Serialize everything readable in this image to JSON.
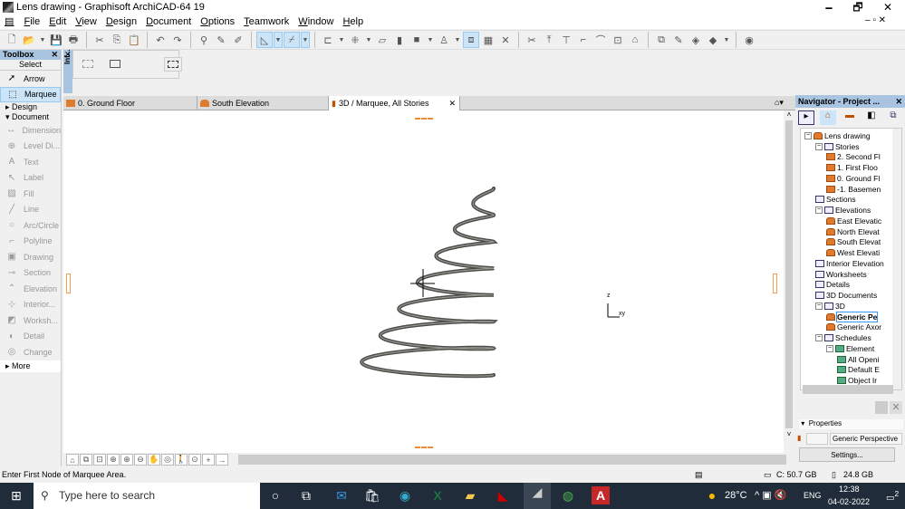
{
  "window": {
    "title": "Lens drawing - Graphisoft ArchiCAD-64 19",
    "minimize": "🗕",
    "maximize": "🗗",
    "close": "✕"
  },
  "menu": [
    "File",
    "Edit",
    "View",
    "Design",
    "Document",
    "Options",
    "Teamwork",
    "Window",
    "Help"
  ],
  "toolbar": [
    "new-file",
    "open-folder",
    "dd",
    "save",
    "print",
    "sep",
    "cut",
    "copy",
    "paste",
    "sep",
    "undo",
    "redo",
    "sep",
    "find-select",
    "eyedropper",
    "syringe",
    "sep",
    "guide-lines:act",
    "dd:act",
    "snap-guides:act",
    "dd:act",
    "sep",
    "align",
    "dd",
    "distribute",
    "dd",
    "slab-tool",
    "wall-tool",
    "fill-tool",
    "dd",
    "object-tool",
    "dd",
    "trace:act",
    "reference",
    "cross",
    "sep",
    "split",
    "adjust",
    "elevate",
    "fillet",
    "curve",
    "offset",
    "roof-tool",
    "sep",
    "layer-combo",
    "renovation",
    "graphic-override",
    "view-options",
    "dd",
    "sep",
    "bimx-publish"
  ],
  "toolbox": {
    "title": "Toolbox",
    "close": "✕",
    "select_label": "Select",
    "selection_tools": [
      {
        "label": "Arrow",
        "icon": "➚"
      },
      {
        "label": "Marquee",
        "icon": "⬚",
        "selected": true
      }
    ],
    "sections": {
      "design": "Design",
      "document": "Document",
      "more": "More"
    },
    "document_tools": [
      {
        "label": "Dimension",
        "icon": "↔"
      },
      {
        "label": "Level Di...",
        "icon": "⊕"
      },
      {
        "label": "Text",
        "icon": "A"
      },
      {
        "label": "Label",
        "icon": "↖"
      },
      {
        "label": "Fill",
        "icon": "▨"
      },
      {
        "label": "Line",
        "icon": "╱"
      },
      {
        "label": "Arc/Circle",
        "icon": "○"
      },
      {
        "label": "Polyline",
        "icon": "⌐"
      },
      {
        "label": "Drawing",
        "icon": "▣"
      },
      {
        "label": "Section",
        "icon": "⊸"
      },
      {
        "label": "Elevation",
        "icon": "⌃"
      },
      {
        "label": "Interior...",
        "icon": "⊹"
      },
      {
        "label": "Worksh...",
        "icon": "◩"
      },
      {
        "label": "Detail",
        "icon": "◐"
      },
      {
        "label": "Change",
        "icon": "◎"
      }
    ]
  },
  "infobox": {
    "side_label": "Inf...",
    "close": "✕"
  },
  "tabs": [
    {
      "label": "0. Ground Floor",
      "icon": "floor-plan"
    },
    {
      "label": "South Elevation",
      "icon": "elevation"
    },
    {
      "label": "3D / Marquee, All Stories",
      "icon": "camera",
      "active": true,
      "close": "✕"
    }
  ],
  "canvas": {
    "axis_z": "z",
    "axis_xy": "xy"
  },
  "navigator": {
    "title": "Navigator - Project ...",
    "close": "✕",
    "tree": [
      {
        "label": "Lens drawing",
        "lvl": 0,
        "t": "-",
        "ic": "el"
      },
      {
        "label": "Stories",
        "lvl": 1,
        "t": "-",
        "ic": ""
      },
      {
        "label": "2. Second Fl",
        "lvl": 2,
        "ic": "fl"
      },
      {
        "label": "1. First  Floo",
        "lvl": 2,
        "ic": "fl"
      },
      {
        "label": "0. Ground Fl",
        "lvl": 2,
        "ic": "fl"
      },
      {
        "label": "-1. Basemen",
        "lvl": 2,
        "ic": "fl"
      },
      {
        "label": "Sections",
        "lvl": 1,
        "ic": ""
      },
      {
        "label": "Elevations",
        "lvl": 1,
        "t": "-",
        "ic": ""
      },
      {
        "label": "East Elevatic",
        "lvl": 2,
        "ic": "el"
      },
      {
        "label": "North Elevat",
        "lvl": 2,
        "ic": "el"
      },
      {
        "label": "South Elevat",
        "lvl": 2,
        "ic": "el"
      },
      {
        "label": "West Elevati",
        "lvl": 2,
        "ic": "el"
      },
      {
        "label": "Interior Elevation",
        "lvl": 1,
        "ic": ""
      },
      {
        "label": "Worksheets",
        "lvl": 1,
        "ic": ""
      },
      {
        "label": "Details",
        "lvl": 1,
        "ic": ""
      },
      {
        "label": "3D Documents",
        "lvl": 1,
        "ic": ""
      },
      {
        "label": "3D",
        "lvl": 1,
        "t": "-",
        "ic": ""
      },
      {
        "label": "Generic Pe",
        "lvl": 2,
        "ic": "el",
        "selected": true
      },
      {
        "label": "Generic Axor",
        "lvl": 2,
        "ic": "el"
      },
      {
        "label": "Schedules",
        "lvl": 1,
        "t": "-",
        "ic": ""
      },
      {
        "label": "Element",
        "lvl": 2,
        "t": "-",
        "ic": "sc"
      },
      {
        "label": "All Openi",
        "lvl": 3,
        "ic": "sc"
      },
      {
        "label": "Default E",
        "lvl": 3,
        "ic": "sc"
      },
      {
        "label": "Object Ir",
        "lvl": 3,
        "ic": "sc"
      }
    ],
    "properties_label": "Properties",
    "view_name": "Generic Perspective",
    "settings_label": "Settings..."
  },
  "status": {
    "prompt": "Enter First Node of Marquee Area.",
    "disk": "C: 50.7 GB",
    "memory": "24.8 GB"
  },
  "taskbar": {
    "search_placeholder": "Type here to search",
    "weather": "28°C",
    "language": "ENG",
    "time": "12:38",
    "date": "04-02-2022",
    "notifications": "2"
  }
}
